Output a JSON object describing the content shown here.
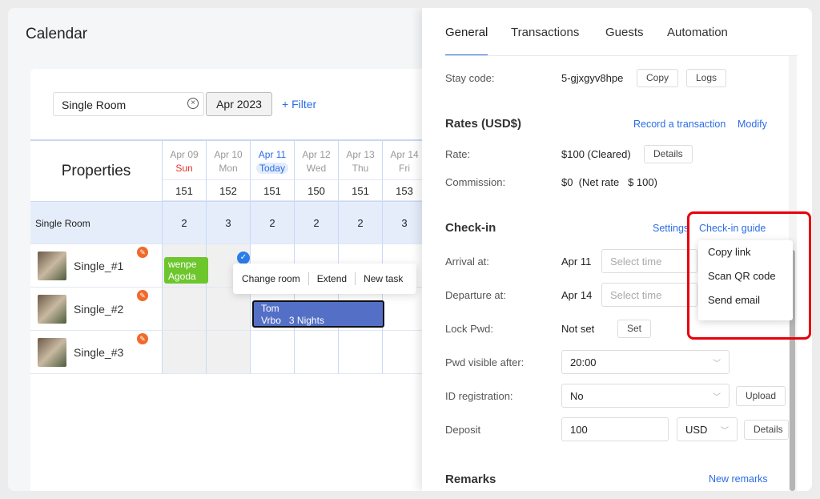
{
  "calendar": {
    "title": "Calendar",
    "search_value": "Single Room",
    "month": "Apr 2023",
    "filter": "+ Filter",
    "properties_header": "Properties",
    "days": [
      {
        "date": "Apr 09",
        "dow": "Sun",
        "count": "151",
        "avail": "2"
      },
      {
        "date": "Apr 10",
        "dow": "Mon",
        "count": "152",
        "avail": "3"
      },
      {
        "date": "Apr 11",
        "dow": "Today",
        "count": "151",
        "avail": "2"
      },
      {
        "date": "Apr 12",
        "dow": "Wed",
        "count": "150",
        "avail": "2"
      },
      {
        "date": "Apr 13",
        "dow": "Thu",
        "count": "151",
        "avail": "2"
      },
      {
        "date": "Apr 14",
        "dow": "Fri",
        "count": "153",
        "avail": "3"
      }
    ],
    "room_type": "Single Room",
    "rooms": [
      "Single_#1",
      "Single_#2",
      "Single_#3"
    ],
    "booking1": {
      "guest": "wenpe",
      "channel": "Agoda",
      "color": "#6cc62c"
    },
    "booking2": {
      "guest": "Tom",
      "channel": "Vrbo",
      "nights": "3 Nights",
      "color": "#5470c6"
    },
    "popover": [
      "Change room",
      "Extend",
      "New task"
    ]
  },
  "panel": {
    "tabs": [
      "General",
      "Transactions",
      "Guests",
      "Automation"
    ],
    "stay_code": {
      "label": "Stay code:",
      "value": "5-gjxgyv8hpe",
      "copy": "Copy",
      "logs": "Logs"
    },
    "rates": {
      "title": "Rates (USD$)",
      "record": "Record a transaction",
      "modify": "Modify",
      "rate_label": "Rate:",
      "rate_value": "$100 (Cleared)",
      "details": "Details",
      "commission_label": "Commission:",
      "commission_value": "$0  (Net rate   $ 100)"
    },
    "checkin": {
      "title": "Check-in",
      "settings": "Settings",
      "guide": "Check-in guide",
      "arrival_label": "Arrival at:",
      "arrival_date": "Apr 11",
      "departure_label": "Departure at:",
      "departure_date": "Apr 14",
      "time_placeholder": "Select time",
      "lock_label": "Lock Pwd:",
      "lock_value": "Not set",
      "set": "Set",
      "pwd_label": "Pwd visible after:",
      "pwd_value": "20:00",
      "id_label": "ID registration:",
      "id_value": "No",
      "upload": "Upload",
      "deposit_label": "Deposit",
      "deposit_value": "100",
      "currency": "USD",
      "details": "Details"
    },
    "guide_menu": [
      "Copy link",
      "Scan QR code",
      "Send email"
    ],
    "remarks": {
      "title": "Remarks",
      "new": "New remarks"
    }
  },
  "colors": {
    "accent": "#2b6de5",
    "highlight": "#e8000b",
    "sunday": "#e8322b"
  }
}
